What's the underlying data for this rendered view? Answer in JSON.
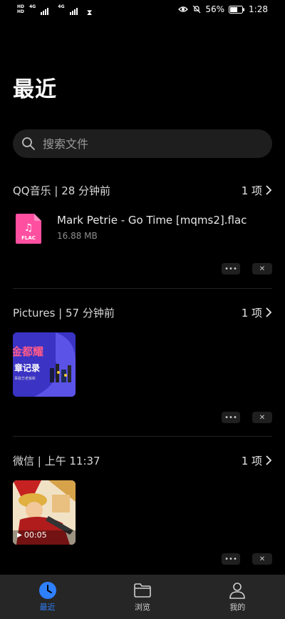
{
  "status": {
    "battery": "56%",
    "time": "1:28",
    "net1": "4G",
    "net2": "4G"
  },
  "page": {
    "title": "最近"
  },
  "search": {
    "placeholder": "搜索文件"
  },
  "sections": [
    {
      "title": "QQ音乐 | 28 分钟前",
      "count": "1 项",
      "file": {
        "name": "Mark Petrie - Go Time [mqms2].flac",
        "size": "16.88 MB",
        "type_label": "FLAC"
      }
    },
    {
      "title": "Pictures | 57 分钟前",
      "count": "1 项",
      "thumb_text": {
        "line1": "金都耀",
        "line2": "章记录",
        "line3": "事故方老板新"
      }
    },
    {
      "title": "微信 | 上午 11:37",
      "count": "1 项",
      "video": {
        "duration": "00:05"
      }
    }
  ],
  "nav": [
    {
      "label": "最近",
      "icon": "clock-icon",
      "active": true
    },
    {
      "label": "浏览",
      "icon": "folder-icon"
    },
    {
      "label": "我的",
      "icon": "person-icon"
    }
  ],
  "colors": {
    "accent": "#2f80ff",
    "flac": "#ff4fa0",
    "banner": "#4a3fd8"
  }
}
